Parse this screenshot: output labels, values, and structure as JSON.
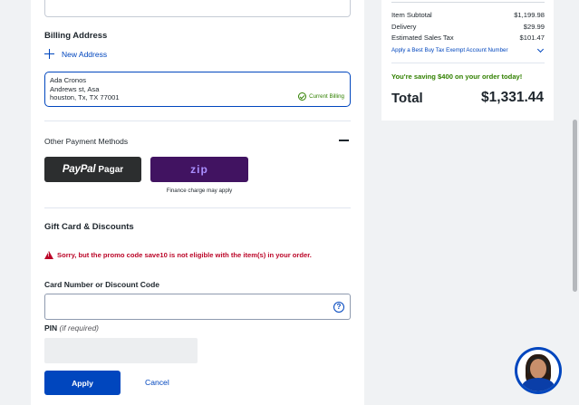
{
  "billing": {
    "title": "Billing Address",
    "new_address_label": "New Address",
    "address_lines": [
      "Ada Cronos",
      "Andrews st, Asa",
      "houston, Tx, TX 77001"
    ],
    "current_billing_label": "Current Billing"
  },
  "payment": {
    "other_methods_label": "Other Payment Methods",
    "paypal_logo": "PayPal",
    "paypal_text": "Pagar",
    "zip_logo": "zip",
    "finance_note": "Finance charge may apply"
  },
  "gift": {
    "title": "Gift Card & Discounts",
    "error_message": "Sorry, but the promo code save10 is not eligible with the item(s) in your order.",
    "card_label": "Card Number or Discount Code",
    "card_value": "",
    "help_symbol": "?",
    "pin_label": "PIN",
    "pin_hint": "(if required)",
    "apply_label": "Apply",
    "cancel_label": "Cancel"
  },
  "summary": {
    "rows": [
      {
        "label": "Item Subtotal",
        "value": "$1,199.98"
      },
      {
        "label": "Delivery",
        "value": "$29.99"
      },
      {
        "label": "Estimated Sales Tax",
        "value": "$101.47"
      }
    ],
    "tax_exempt_link": "Apply a Best Buy Tax Exempt Account Number",
    "saving_message": "You're saving $400 on your order today!",
    "total_label": "Total",
    "total_value": "$1,331.44"
  },
  "colors": {
    "accent": "#0046be",
    "success": "#318000",
    "error": "#bb0628",
    "paypal": "#2c2e2f",
    "zip": "#411361"
  },
  "icons": [
    "plus-icon",
    "check-circle-icon",
    "minus-icon",
    "alert-icon",
    "help-icon",
    "chevron-down-icon",
    "chat-agent-avatar"
  ]
}
